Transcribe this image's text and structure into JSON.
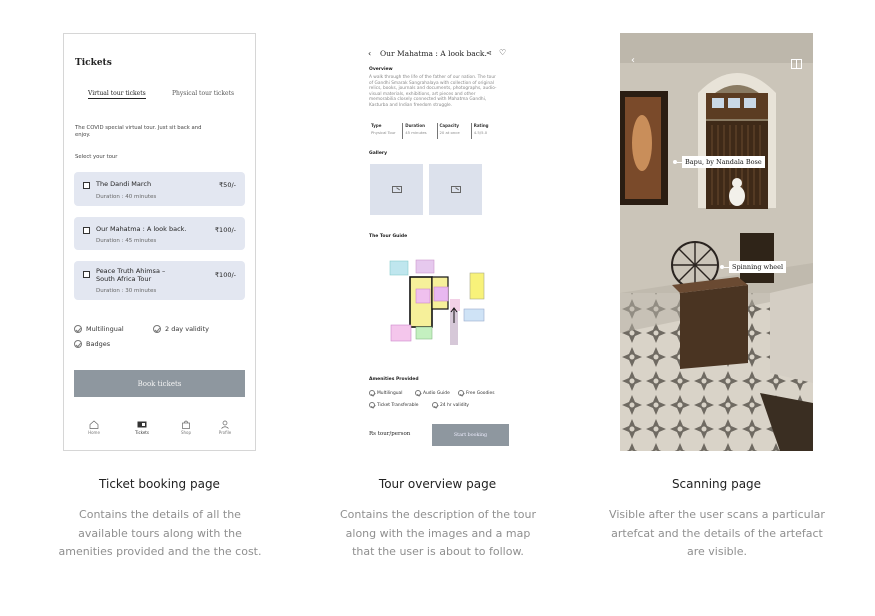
{
  "screens": [
    {
      "title": "Tickets",
      "tabs": [
        "Virtual tour tickets",
        "Physical tour tickets"
      ],
      "intro": "The COVID special virtual tour. Just sit back and enjoy.",
      "select_label": "Select your tour",
      "tours": [
        {
          "name": "The Dandi March",
          "price": "₹50/-",
          "duration": "Duration : 40 minutes"
        },
        {
          "name": "Our Mahatma : A look back.",
          "price": "₹100/-",
          "duration": "Duration : 45 minutes"
        },
        {
          "name_line1": "Peace Truth Ahimsa –",
          "name_line2": "South Africa Tour",
          "price": "₹100/-",
          "duration": "Duration : 30 minutes"
        }
      ],
      "amenities": [
        "Multilingual",
        "2 day validity",
        "Badges"
      ],
      "book_button": "Book tickets",
      "nav": [
        "Home",
        "Tickets",
        "Shop",
        "Profile"
      ]
    },
    {
      "title": "Our Mahatma : A look back.",
      "overview_heading": "Overview",
      "overview_text": "A walk through the life of the father of our nation. The tour of Gandhi Smarak Sangrahalaya with collection of original relics, books, journals and documents, photographs, audio-visual materials, exhibitions, art pieces and other memorabilia closely connected with Mahatma Gandhi, Kasturba and Indian freedom struggle.",
      "stats": [
        {
          "key": "Type",
          "value": "Physical Tour"
        },
        {
          "key": "Duration",
          "value": "45 minutes"
        },
        {
          "key": "Capacity",
          "value": "20 at once"
        },
        {
          "key": "Rating",
          "value": "4.5/5.0"
        }
      ],
      "gallery_heading": "Gallery",
      "guide_heading": "The Tour Guide",
      "amenities_heading": "Amenities Provided",
      "amenities": [
        "Multilingual",
        "Audio Guide",
        "Free Goodies",
        "Ticket Transferable",
        "24 hr validity"
      ],
      "price": "Rs tour/person",
      "button": "Start booking"
    },
    {
      "tags": [
        "Bapu, by Nandala Bose",
        "Spinning wheel"
      ]
    }
  ],
  "captions": [
    {
      "title": "Ticket booking page",
      "lines": [
        "Contains the details of all the",
        "available tours along with the",
        "amenities provided and the the cost."
      ]
    },
    {
      "title": "Tour overview page",
      "lines": [
        "Contains the description of the tour",
        "along with the images and a map",
        "that the user is about to follow."
      ]
    },
    {
      "title": "Scanning page",
      "lines": [
        "Visible after the user scans a particular",
        "artefcat and the details of the artefact",
        "are visible."
      ]
    }
  ],
  "colors": {
    "card": "#e3e7f1",
    "button": "#8e979f",
    "gallery": "#dce1ec"
  }
}
